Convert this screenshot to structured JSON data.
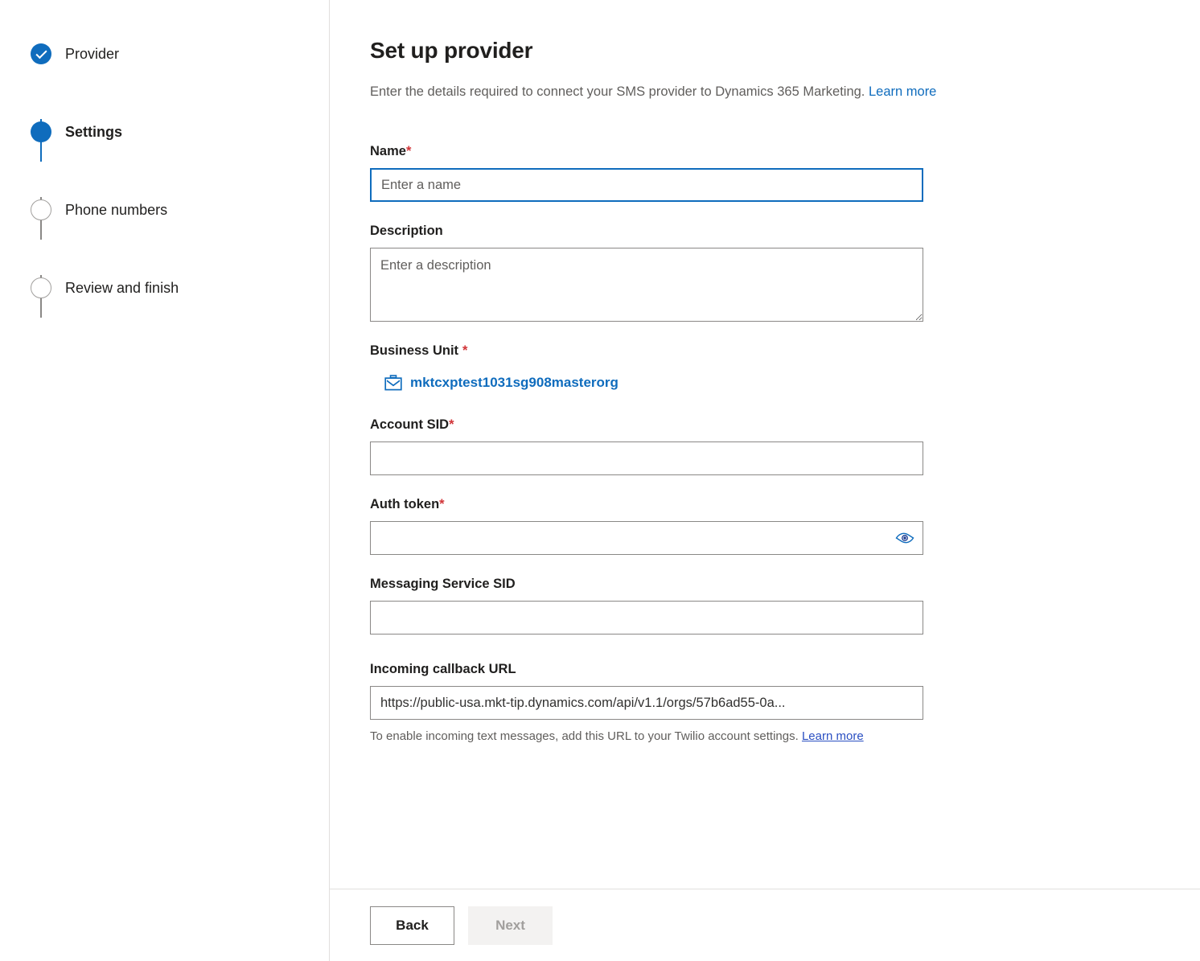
{
  "wizard": {
    "steps": [
      {
        "label": "Provider",
        "state": "done"
      },
      {
        "label": "Settings",
        "state": "current"
      },
      {
        "label": "Phone numbers",
        "state": "todo"
      },
      {
        "label": "Review and finish",
        "state": "todo"
      }
    ]
  },
  "header": {
    "title": "Set up provider",
    "subtitle": "Enter the details required to connect your SMS provider to Dynamics 365 Marketing.",
    "learn_more_label": "Learn more"
  },
  "form": {
    "name": {
      "label": "Name",
      "required_mark": "*",
      "placeholder": "Enter a name",
      "value": ""
    },
    "description": {
      "label": "Description",
      "placeholder": "Enter a description",
      "value": ""
    },
    "business_unit": {
      "label": "Business Unit",
      "required_mark": "*",
      "icon": "business-unit-briefcase-icon",
      "value": "mktcxptest1031sg908masterorg"
    },
    "account_sid": {
      "label": "Account SID",
      "required_mark": "*",
      "placeholder": "",
      "value": ""
    },
    "auth_token": {
      "label": "Auth token",
      "required_mark": "*",
      "placeholder": "",
      "value": "",
      "reveal_icon": "eye-icon"
    },
    "messaging_service_sid": {
      "label": "Messaging Service SID",
      "placeholder": "",
      "value": ""
    },
    "incoming_callback_url": {
      "label": "Incoming callback URL",
      "value": "https://public-usa.mkt-tip.dynamics.com/api/v1.1/orgs/57b6ad55-0a...",
      "help_text": "To enable incoming text messages, add this URL to your Twilio account settings.",
      "help_link_label": "Learn more"
    }
  },
  "footer": {
    "back_label": "Back",
    "next_label": "Next"
  },
  "colors": {
    "accent_blue": "#0f6cbd",
    "link_blue": "#0078d4",
    "required_red": "#d13438",
    "visited_link": "#2a4fc2",
    "inactive_grey": "#8a8886",
    "disabled_text": "#a19f9d",
    "disabled_bg": "#f3f2f1",
    "border_grey": "#e1dfdd"
  }
}
